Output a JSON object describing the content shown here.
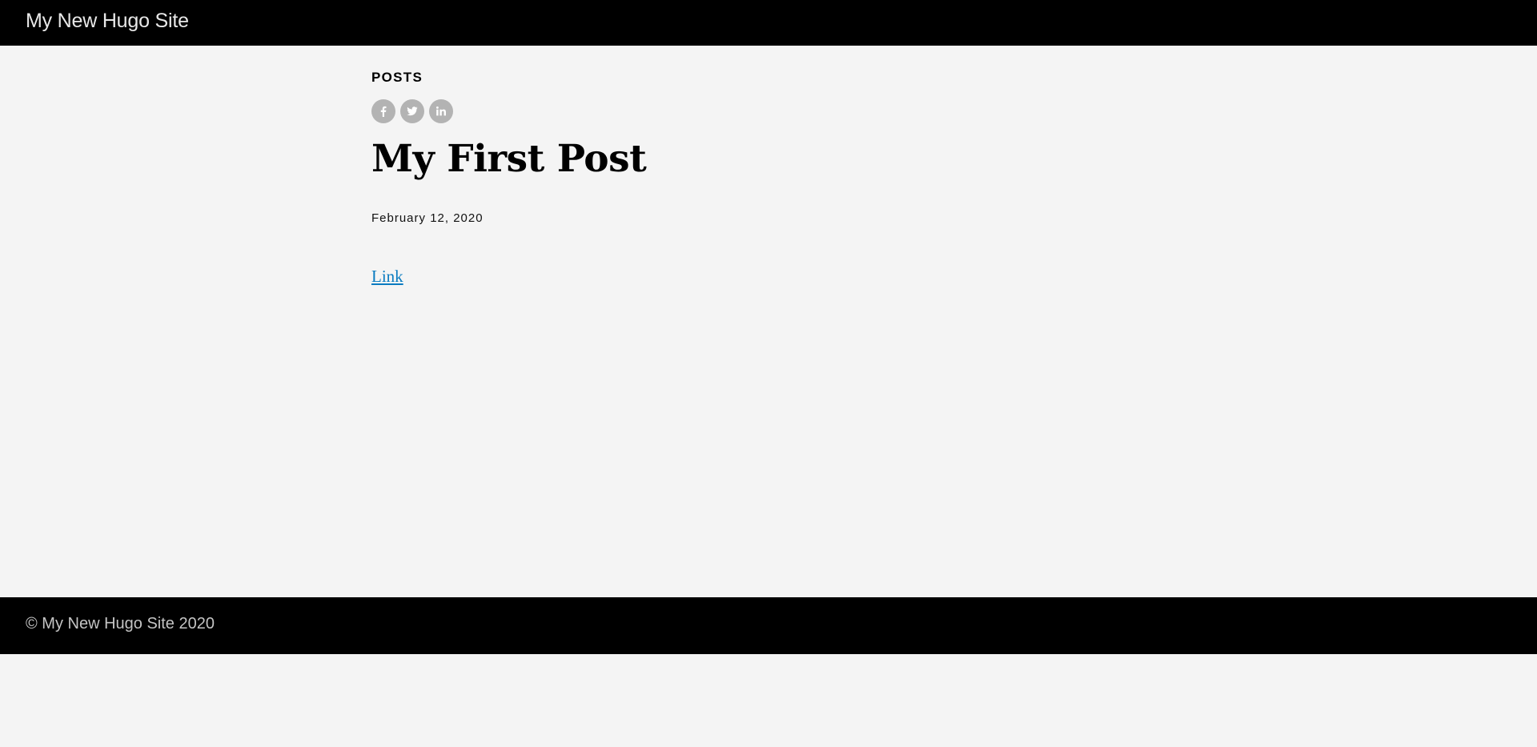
{
  "header": {
    "site_title": "My New Hugo Site"
  },
  "post": {
    "section": "POSTS",
    "share_icons": [
      "facebook-icon",
      "twitter-icon",
      "linkedin-icon"
    ],
    "title": "My First Post",
    "date": "February 12, 2020",
    "link_text": "Link"
  },
  "footer": {
    "copyright": "© My New Hugo Site 2020"
  },
  "colors": {
    "header_bg": "#000000",
    "page_bg": "#f4f4f4",
    "share_icon_bg": "#b3b3b3",
    "link": "#0a7bc0"
  }
}
